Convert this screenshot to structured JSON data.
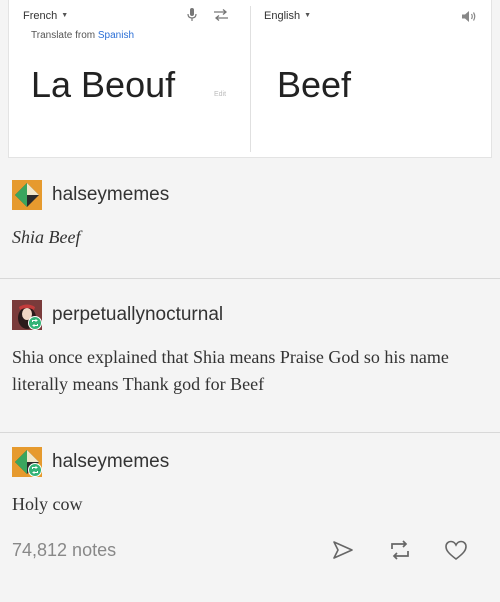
{
  "translate": {
    "source_lang": "French",
    "translated_from": "Translate from",
    "detected_lang": "Spanish",
    "target_lang": "English",
    "source_text": "La Beouf",
    "edit_label": "Edit",
    "target_text": "Beef"
  },
  "posts": [
    {
      "username": "halseymemes",
      "body": "Shia Beef"
    },
    {
      "username": "perpetuallynocturnal",
      "body": "Shia once explained that Shia means Praise God so his name literally means Thank god for Beef"
    },
    {
      "username": "halseymemes",
      "body": "Holy cow"
    }
  ],
  "footer": {
    "notes": "74,812 notes"
  },
  "colors": {
    "accent_blue": "#2b6fd6",
    "reblog_green": "#34b377"
  },
  "icons": [
    "microphone-icon",
    "swap-languages-icon",
    "speaker-icon",
    "share-icon",
    "reblog-icon",
    "heart-icon"
  ]
}
